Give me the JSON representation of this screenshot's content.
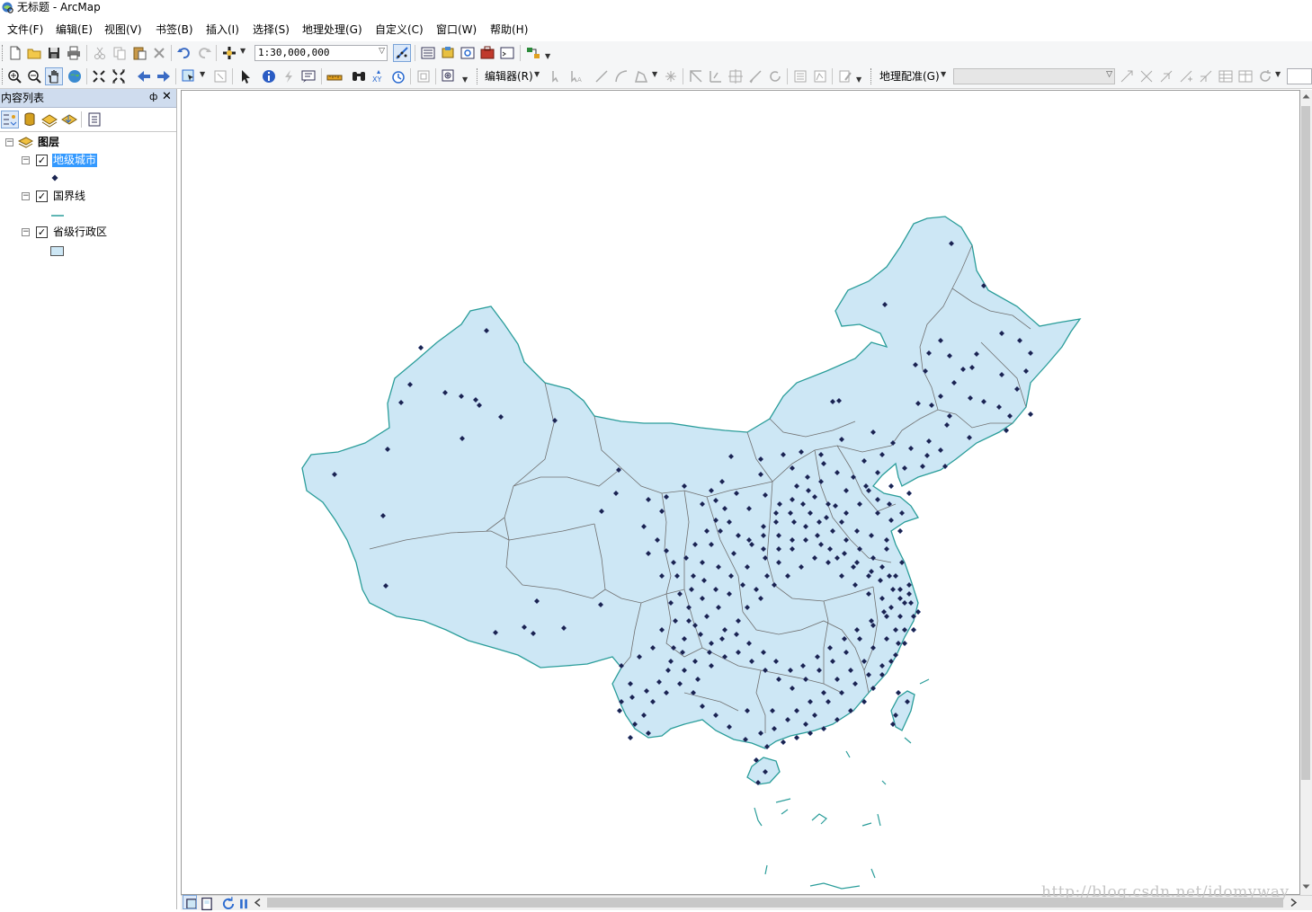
{
  "window": {
    "title": "无标题 - ArcMap"
  },
  "menubar": [
    "文件(F)",
    "编辑(E)",
    "视图(V)",
    "书签(B)",
    "插入(I)",
    "选择(S)",
    "地理处理(G)",
    "自定义(C)",
    "窗口(W)",
    "帮助(H)"
  ],
  "toolbar": {
    "scale": "1:30,000,000",
    "editor_label": "编辑器(R)",
    "georef_label": "地理配准(G)",
    "georef_layer": ""
  },
  "toc": {
    "title": "内容列表",
    "pin_glyph": "ф",
    "close_glyph": "✕",
    "root": "图层",
    "layers": [
      {
        "name": "地级城市",
        "checked": true,
        "selected": true,
        "symbol": "point"
      },
      {
        "name": "国界线",
        "checked": true,
        "selected": false,
        "symbol": "line"
      },
      {
        "name": "省级行政区",
        "checked": true,
        "selected": false,
        "symbol": "polygon"
      }
    ]
  },
  "map": {
    "fill_color": "#cde7f5",
    "boundary_color": "#2a9d9a",
    "province_line_color": "#707070",
    "city_color": "#1a2450"
  },
  "watermark": "http://blog.csdn.net/idomyway",
  "icons": [
    "new-document-icon",
    "open-folder-icon",
    "save-icon",
    "print-icon",
    "cut-icon",
    "copy-icon",
    "paste-icon",
    "delete-icon",
    "undo-icon",
    "redo-icon",
    "add-data-icon",
    "editor-toolbar-icon",
    "table-of-contents-icon",
    "catalog-icon",
    "search-window-icon",
    "arctoolbox-icon",
    "python-icon",
    "model-builder-icon",
    "zoom-in-icon",
    "zoom-out-icon",
    "pan-icon",
    "full-extent-icon",
    "fixed-zoom-in-icon",
    "fixed-zoom-out-icon",
    "back-icon",
    "forward-icon",
    "select-features-icon",
    "clear-selection-icon",
    "select-elements-icon",
    "identify-icon",
    "hyperlink-icon",
    "html-popup-icon",
    "measure-icon",
    "find-icon",
    "go-to-xy-icon",
    "time-slider-icon",
    "create-viewer-window-icon",
    "list-by-drawing-order-icon",
    "list-by-source-icon",
    "list-by-visibility-icon",
    "list-by-selection-icon",
    "options-icon"
  ]
}
